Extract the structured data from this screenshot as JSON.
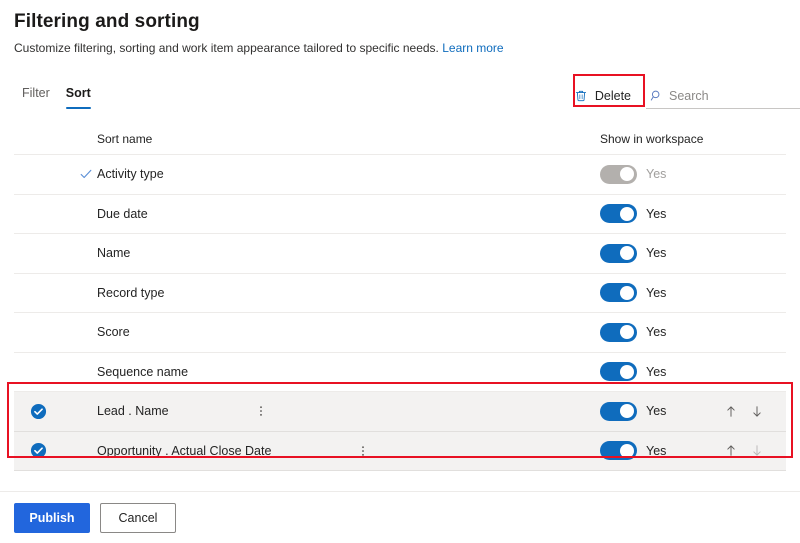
{
  "header": {
    "title": "Filtering and sorting",
    "subtitle": "Customize filtering, sorting and work item appearance tailored to specific needs.",
    "learn_more": "Learn more"
  },
  "tabs": [
    {
      "label": "Filter",
      "active": false
    },
    {
      "label": "Sort",
      "active": true
    }
  ],
  "toolbar": {
    "delete_label": "Delete",
    "search_placeholder": "Search",
    "search_value": ""
  },
  "table": {
    "columns": {
      "sort_name": "Sort name",
      "show_in_workspace": "Show in workspace"
    },
    "rows": [
      {
        "name": "Activity type",
        "toggle_label": "Yes",
        "toggle_on": true,
        "toggle_disabled": true,
        "selected": false,
        "hovered": true,
        "has_arrows": false
      },
      {
        "name": "Due date",
        "toggle_label": "Yes",
        "toggle_on": true,
        "toggle_disabled": false,
        "selected": false,
        "hovered": false,
        "has_arrows": false
      },
      {
        "name": "Name",
        "toggle_label": "Yes",
        "toggle_on": true,
        "toggle_disabled": false,
        "selected": false,
        "hovered": false,
        "has_arrows": false
      },
      {
        "name": "Record type",
        "toggle_label": "Yes",
        "toggle_on": true,
        "toggle_disabled": false,
        "selected": false,
        "hovered": false,
        "has_arrows": false
      },
      {
        "name": "Score",
        "toggle_label": "Yes",
        "toggle_on": true,
        "toggle_disabled": false,
        "selected": false,
        "hovered": false,
        "has_arrows": false
      },
      {
        "name": "Sequence name",
        "toggle_label": "Yes",
        "toggle_on": true,
        "toggle_disabled": false,
        "selected": false,
        "hovered": false,
        "has_arrows": false
      },
      {
        "name": "Lead . Name",
        "toggle_label": "Yes",
        "toggle_on": true,
        "toggle_disabled": false,
        "selected": true,
        "hovered": false,
        "has_arrows": true,
        "move_up_enabled": true,
        "move_down_enabled": true
      },
      {
        "name": "Opportunity . Actual Close Date",
        "toggle_label": "Yes",
        "toggle_on": true,
        "toggle_disabled": false,
        "selected": true,
        "hovered": false,
        "has_arrows": true,
        "move_up_enabled": true,
        "move_down_enabled": false
      }
    ]
  },
  "footer": {
    "publish_label": "Publish",
    "cancel_label": "Cancel"
  },
  "colors": {
    "accent": "#0f6cbd",
    "primary_button": "#2266dd",
    "annotation": "#e81123",
    "link": "#0f6cbd",
    "disabled_toggle": "#b3b0ad",
    "selected_row_bg": "#f3f2f1"
  }
}
